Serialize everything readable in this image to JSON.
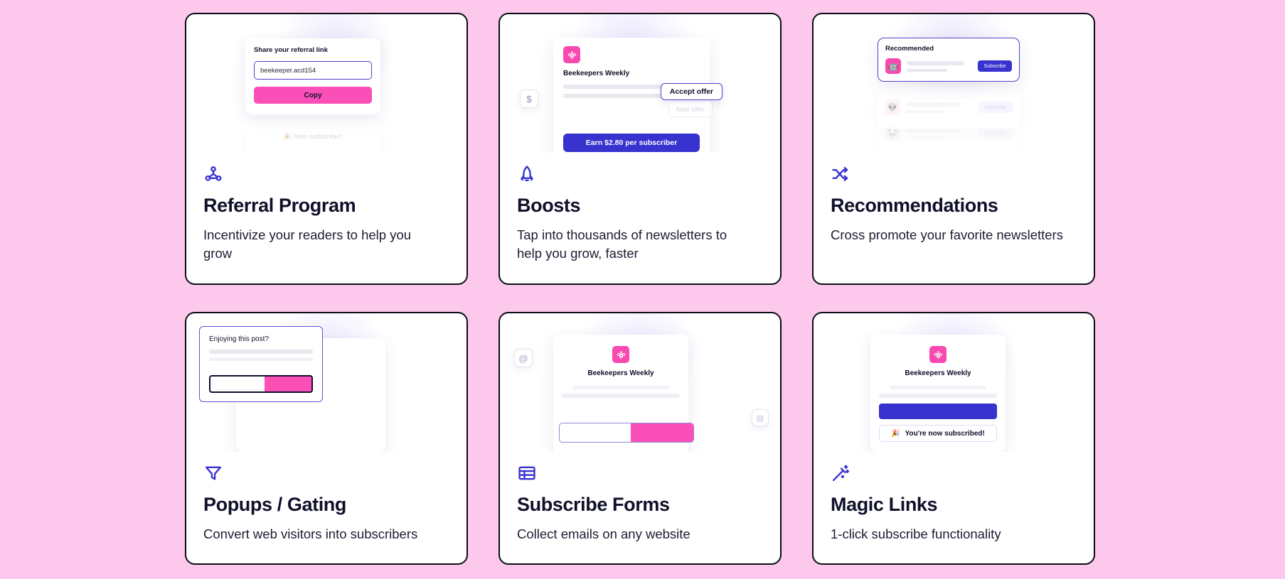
{
  "page": {
    "background_color": "#fcc9ec",
    "accent_blue": "#3832cf",
    "accent_pink": "#fa4fb6",
    "text_dark": "#10102a"
  },
  "cards": [
    {
      "icon": "share-nodes-icon",
      "title": "Referral Program",
      "description": "Incentivize your readers to help you grow",
      "illustration": {
        "panel_label": "Share your referral link",
        "input_value": "beekeeper.acd154",
        "button_label": "Copy",
        "toast_label": "🎉 New subscriber!"
      }
    },
    {
      "icon": "rocket-icon",
      "title": "Boosts",
      "description": "Tap into thousands of newsletters to help you grow, faster",
      "illustration": {
        "publication_name": "Beekeepers Weekly",
        "accept_label": "Accept offer",
        "new_offer_label": "New offer",
        "earn_label": "Earn $2.80 per subscriber",
        "dollar_chip": "$"
      }
    },
    {
      "icon": "shuffle-icon",
      "title": "Recommendations",
      "description": "Cross promote your favorite newsletters",
      "illustration": {
        "panel_title": "Recommended",
        "subscribe_label": "Subscribe",
        "rows": [
          {
            "avatar": "🤖",
            "subscribe_label": "Subscribe"
          },
          {
            "avatar": "👽",
            "subscribe_label": "Subscribe"
          },
          {
            "avatar": "🐼",
            "subscribe_label": "Subscribe"
          }
        ]
      }
    },
    {
      "icon": "funnel-icon",
      "title": "Popups / Gating",
      "description": "Convert web visitors into subscribers",
      "illustration": {
        "popup_title": "Enjoying this post?"
      }
    },
    {
      "icon": "table-icon",
      "title": "Subscribe Forms",
      "description": "Collect emails on any website",
      "illustration": {
        "publication_name": "Beekeepers Weekly",
        "at_chip": "@"
      }
    },
    {
      "icon": "magic-wand-icon",
      "title": "Magic Links",
      "description": "1-click subscribe functionality",
      "illustration": {
        "publication_name": "Beekeepers Weekly",
        "toast_label": "You're now subscribed!",
        "toast_emoji": "🎉"
      }
    }
  ]
}
